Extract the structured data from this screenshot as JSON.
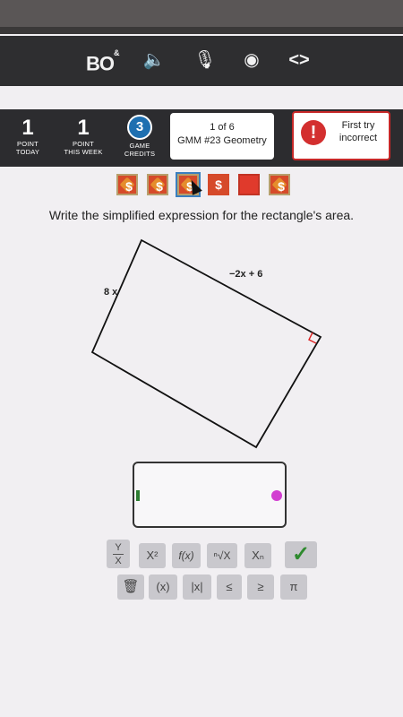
{
  "toolbar": {
    "logo_main": "BO",
    "logo_amp": "&",
    "speaker_icon": "🔈",
    "mic_icon": "🎙",
    "broadcast_icon": "◉",
    "embed_icon": "<>"
  },
  "stats": {
    "points_today_value": "1",
    "points_today_label_1": "POINT",
    "points_today_label_2": "TODAY",
    "points_week_value": "1",
    "points_week_label_1": "POINT",
    "points_week_label_2": "THIS WEEK",
    "credits_value": "3",
    "credits_label_1": "GAME",
    "credits_label_2": "CREDITS"
  },
  "lesson": {
    "progress": "1 of 6",
    "name": "GMM #23 Geometry"
  },
  "alert": {
    "icon": "!",
    "line1": "First try",
    "line2": "incorrect"
  },
  "coins": {
    "symbol": "$"
  },
  "question": {
    "text": "Write the simplified expression for the rectangle's area."
  },
  "figure": {
    "side_a": "8 x",
    "side_b": "−2x + 6"
  },
  "answer": {
    "value": ""
  },
  "keypad": {
    "frac_top": "Y",
    "frac_bottom": "X",
    "power": "X²",
    "function": "f(x)",
    "root": "ⁿ√X",
    "subscript": "Xₙ",
    "submit": "✓",
    "trash": "🗑",
    "paren": "(x)",
    "abs": "|x|",
    "le": "≤",
    "ge": "≥",
    "pi": "π"
  },
  "colors": {
    "accent_blue": "#1e6fb0",
    "alert_red": "#d32f2f",
    "check_green": "#2e8a2e"
  }
}
